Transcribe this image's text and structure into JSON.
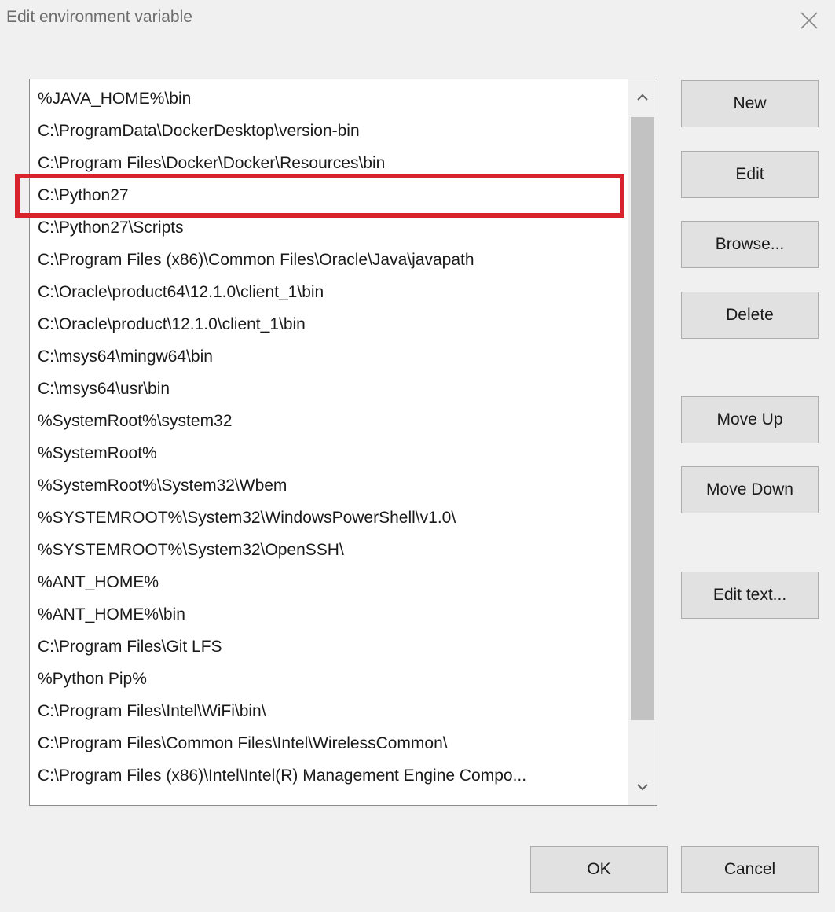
{
  "window": {
    "title": "Edit environment variable",
    "close_icon": "close-icon"
  },
  "path_list": {
    "items": [
      "%JAVA_HOME%\\bin",
      "C:\\ProgramData\\DockerDesktop\\version-bin",
      "C:\\Program Files\\Docker\\Docker\\Resources\\bin",
      "C:\\Python27",
      "C:\\Python27\\Scripts",
      "C:\\Program Files (x86)\\Common Files\\Oracle\\Java\\javapath",
      "C:\\Oracle\\product64\\12.1.0\\client_1\\bin",
      "C:\\Oracle\\product\\12.1.0\\client_1\\bin",
      "C:\\msys64\\mingw64\\bin",
      "C:\\msys64\\usr\\bin",
      "%SystemRoot%\\system32",
      "%SystemRoot%",
      "%SystemRoot%\\System32\\Wbem",
      "%SYSTEMROOT%\\System32\\WindowsPowerShell\\v1.0\\",
      "%SYSTEMROOT%\\System32\\OpenSSH\\",
      "%ANT_HOME%",
      "%ANT_HOME%\\bin",
      "C:\\Program Files\\Git LFS",
      "%Python Pip%",
      "C:\\Program Files\\Intel\\WiFi\\bin\\",
      "C:\\Program Files\\Common Files\\Intel\\WirelessCommon\\",
      "C:\\Program Files (x86)\\Intel\\Intel(R) Management Engine Compo..."
    ],
    "highlighted_item": "C:\\Python27",
    "highlight_color": "#d8232f"
  },
  "side_buttons": {
    "new": "New",
    "edit": "Edit",
    "browse": "Browse...",
    "delete": "Delete",
    "move_up": "Move Up",
    "move_down": "Move Down",
    "edit_text": "Edit text..."
  },
  "footer": {
    "ok": "OK",
    "cancel": "Cancel"
  }
}
